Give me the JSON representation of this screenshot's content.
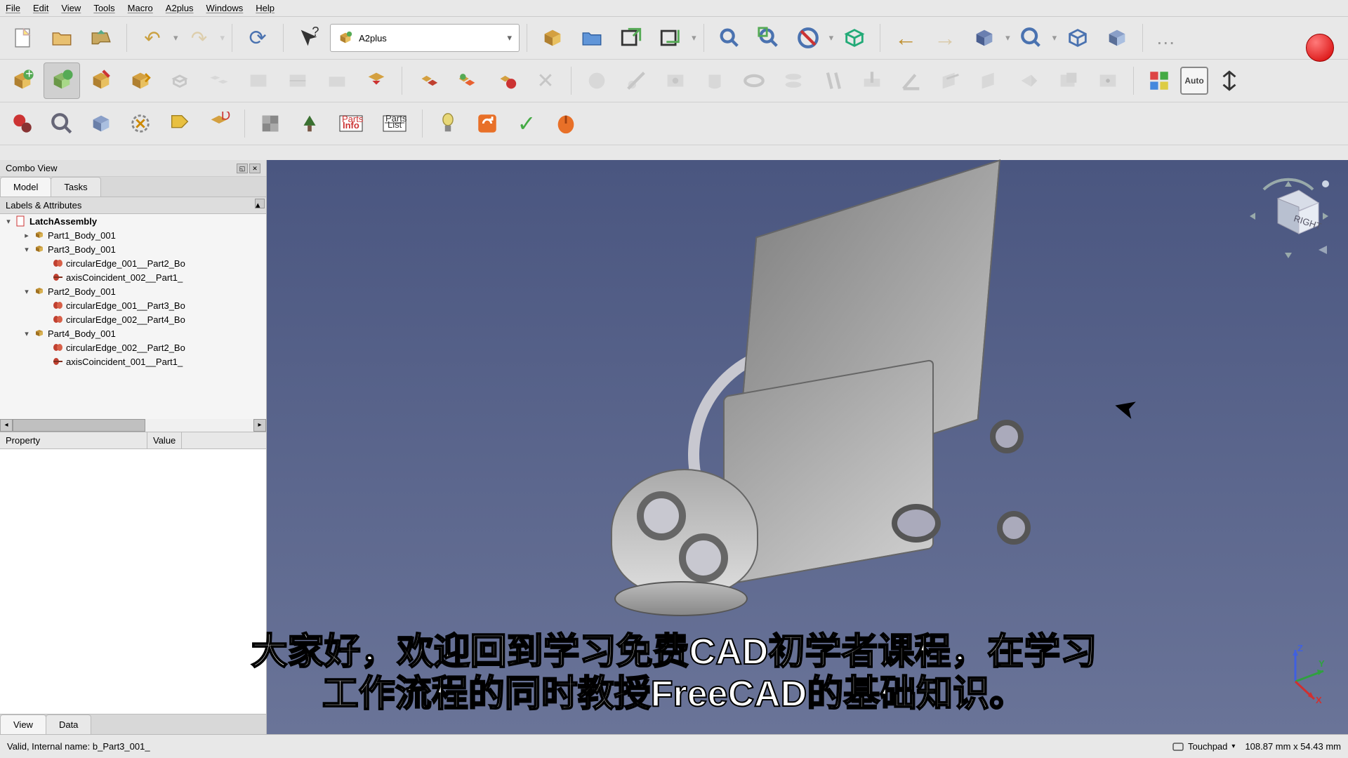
{
  "menubar": [
    "File",
    "Edit",
    "View",
    "Tools",
    "Macro",
    "A2plus",
    "Windows",
    "Help"
  ],
  "workbench": {
    "label": "A2plus"
  },
  "combo": {
    "title": "Combo View",
    "tabs": [
      "Model",
      "Tasks"
    ],
    "active_tab": 0,
    "section": "Labels & Attributes"
  },
  "tree": {
    "root": "LatchAssembly",
    "nodes": [
      {
        "indent": 1,
        "arrow": "▸",
        "icon": "part",
        "label": "Part1_Body_001"
      },
      {
        "indent": 1,
        "arrow": "▾",
        "icon": "part",
        "label": "Part3_Body_001"
      },
      {
        "indent": 2,
        "arrow": "",
        "icon": "circ",
        "label": "circularEdge_001__Part2_Bo"
      },
      {
        "indent": 2,
        "arrow": "",
        "icon": "axis",
        "label": "axisCoincident_002__Part1_"
      },
      {
        "indent": 1,
        "arrow": "▾",
        "icon": "part",
        "label": "Part2_Body_001"
      },
      {
        "indent": 2,
        "arrow": "",
        "icon": "circ",
        "label": "circularEdge_001__Part3_Bo"
      },
      {
        "indent": 2,
        "arrow": "",
        "icon": "circ",
        "label": "circularEdge_002__Part4_Bo"
      },
      {
        "indent": 1,
        "arrow": "▾",
        "icon": "part",
        "label": "Part4_Body_001"
      },
      {
        "indent": 2,
        "arrow": "",
        "icon": "circ",
        "label": "circularEdge_002__Part2_Bo"
      },
      {
        "indent": 2,
        "arrow": "",
        "icon": "axis",
        "label": "axisCoincident_001__Part1_"
      }
    ]
  },
  "property": {
    "cols": [
      "Property",
      "Value"
    ],
    "bottom_tabs": [
      "View",
      "Data"
    ],
    "active_bottom": 0
  },
  "navcube": {
    "face": "RIGHT"
  },
  "axes": {
    "x": "X",
    "y": "Y",
    "z": "Z"
  },
  "subtitle": {
    "line1": "大家好，欢迎回到学习免费CAD初学者课程，在学习",
    "line2": "工作流程的同时教授FreeCAD的基础知识。"
  },
  "statusbar": {
    "left": "Valid, Internal name: b_Part3_001_",
    "nav_mode": "Touchpad",
    "dims": "108.87 mm x 54.43 mm"
  },
  "toolbar_labels": {
    "auto": "Auto",
    "parts_info": "Parts Info",
    "parts_list": "Parts List"
  },
  "icons": {
    "undo": "↶",
    "redo": "↷",
    "refresh": "⟳",
    "help": "?",
    "chevron": "▾",
    "back": "←",
    "fwd": "→",
    "more": "…"
  }
}
